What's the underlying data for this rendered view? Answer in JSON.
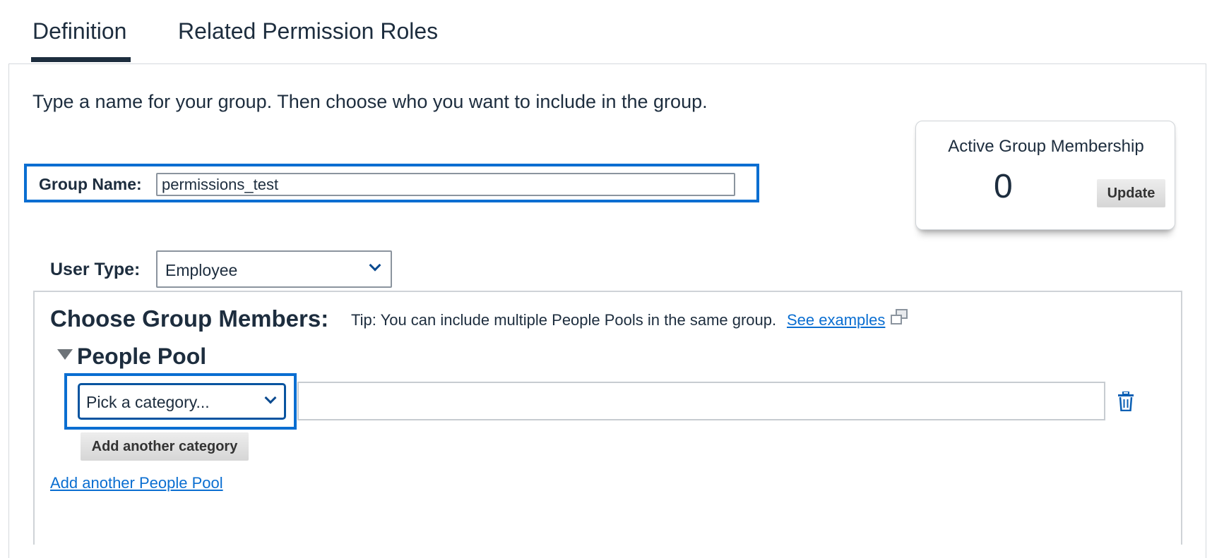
{
  "tabs": [
    {
      "label": "Definition",
      "active": true
    },
    {
      "label": "Related Permission Roles",
      "active": false
    }
  ],
  "intro_text": "Type a name for your group. Then choose who you want to include in the group.",
  "group_name": {
    "label": "Group Name:",
    "value": "permissions_test"
  },
  "membership_card": {
    "title": "Active Group Membership",
    "count": "0",
    "update_label": "Update"
  },
  "user_type": {
    "label": "User Type:",
    "selected": "Employee"
  },
  "members": {
    "title": "Choose Group Members:",
    "tip": "Tip: You can include multiple People Pools in the same group.",
    "see_examples": "See examples",
    "people_pool": {
      "title": "People Pool",
      "category_placeholder": "Pick a category...",
      "add_category_label": "Add another category"
    },
    "add_pool_label": "Add another People Pool"
  },
  "colors": {
    "accent": "#0a6ed1",
    "text": "#1d2d3e",
    "link": "#0a6ed1"
  },
  "icons": [
    "chevron-down-icon",
    "external-window-icon",
    "collapse-triangle-icon",
    "trash-icon"
  ]
}
